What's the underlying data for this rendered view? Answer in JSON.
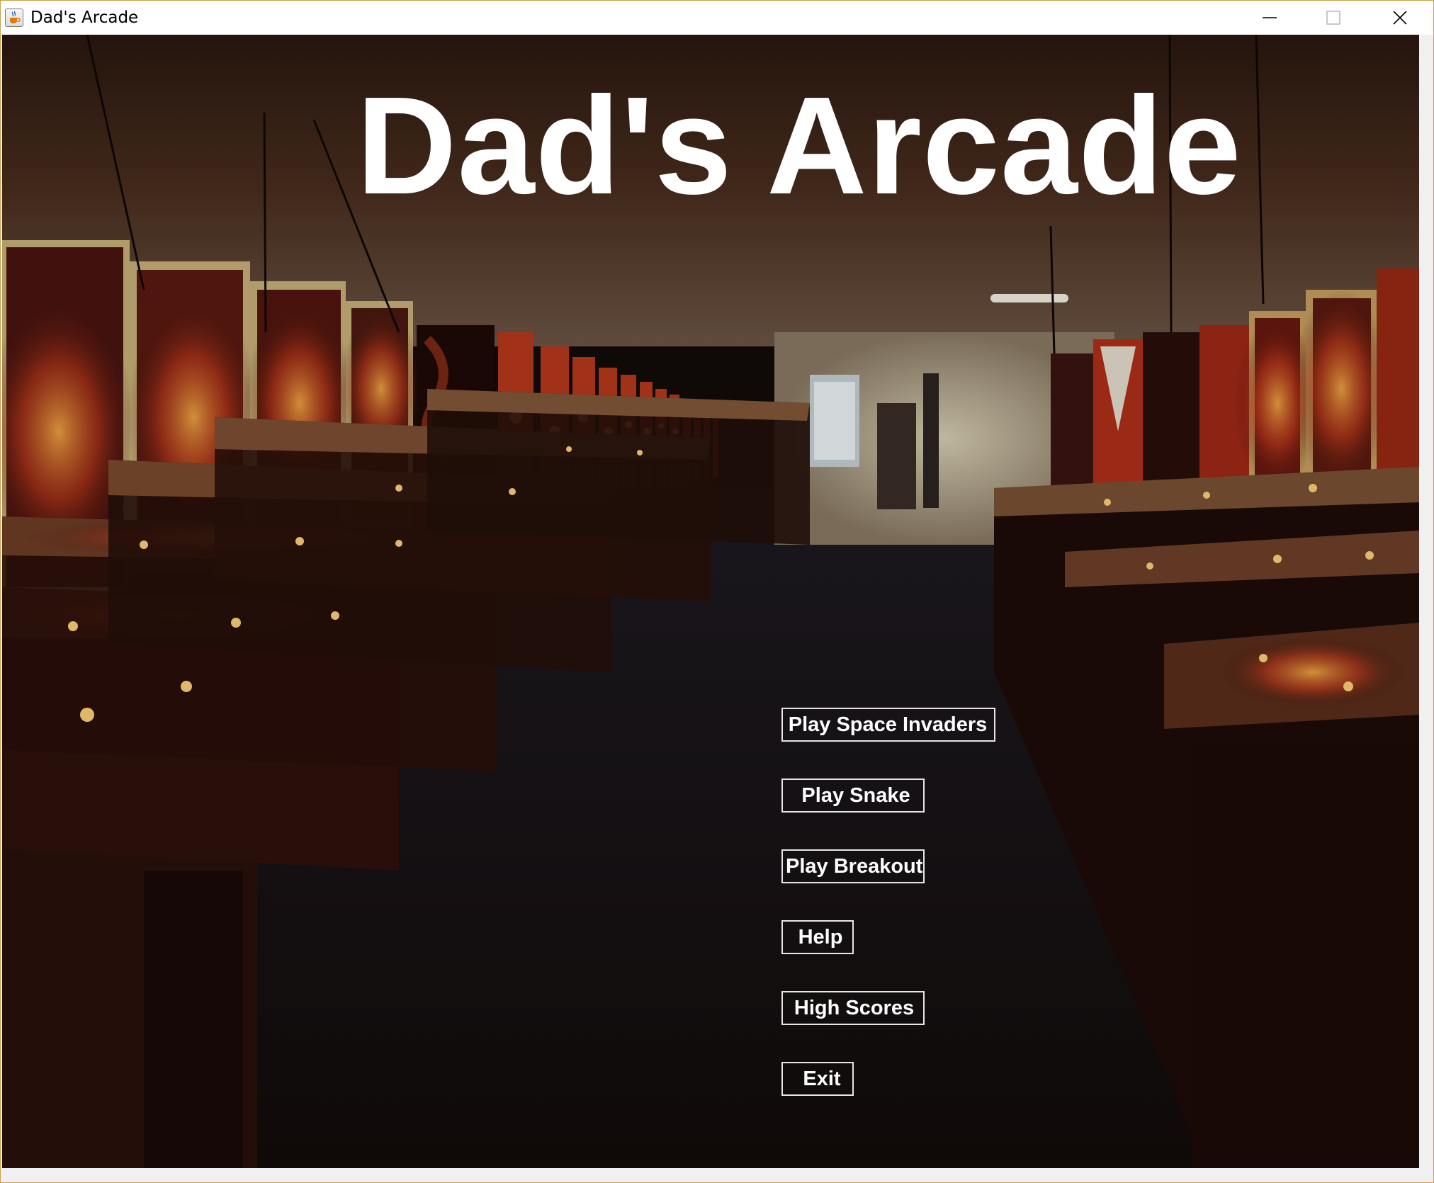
{
  "window": {
    "title": "Dad's Arcade",
    "icon": "java-coffee-cup-icon",
    "controls": {
      "minimize_icon": "minimize-icon",
      "maximize_icon": "maximize-icon",
      "close_icon": "close-icon"
    }
  },
  "main": {
    "headline": "Dad's Arcade",
    "background": "pinball-arcade-photo",
    "menu": {
      "space_invaders": "Play Space Invaders",
      "snake": "Play Snake",
      "breakout": "Play Breakout",
      "help": "Help",
      "high_scores": "High Scores",
      "exit": "Exit"
    }
  },
  "colors": {
    "text": "#ffffff",
    "button_border": "#e6e6e6",
    "titlebar": "#ffffff",
    "window_border": "#c9a24a"
  }
}
